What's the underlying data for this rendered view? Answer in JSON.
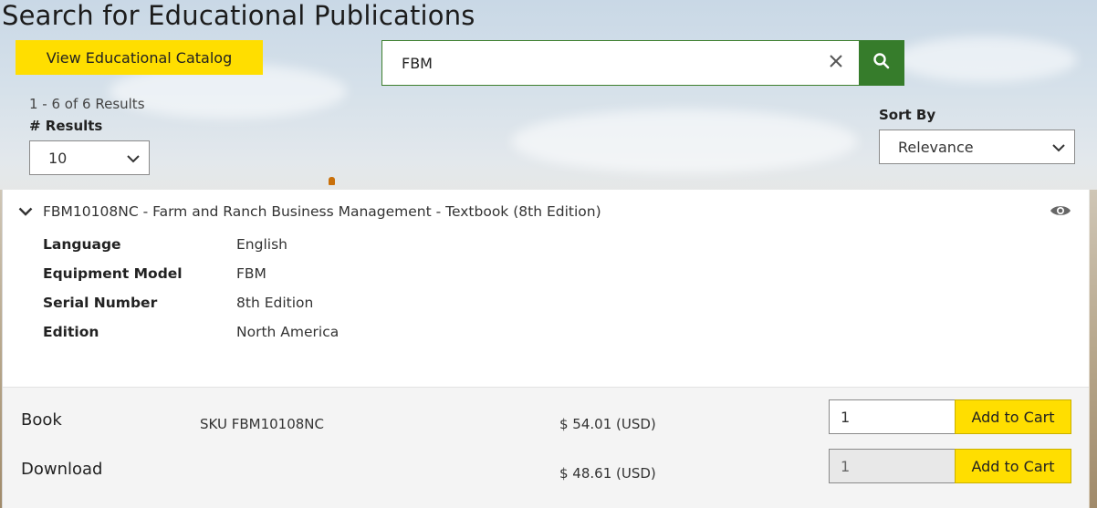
{
  "page": {
    "title": "Search for Educational Publications"
  },
  "catalog_button": {
    "label": "View Educational Catalog"
  },
  "search": {
    "value": "FBM",
    "clear_icon": "close-icon",
    "submit_icon": "search-icon"
  },
  "results": {
    "summary": "1 - 6 of 6 Results",
    "per_page_label": "# Results",
    "per_page_value": "10"
  },
  "sort": {
    "label": "Sort By",
    "value": "Relevance"
  },
  "item": {
    "title": "FBM10108NC - Farm and Ranch Business Management - Textbook (8th Edition)",
    "attributes": [
      {
        "label": "Language",
        "value": "English"
      },
      {
        "label": "Equipment Model",
        "value": "FBM"
      },
      {
        "label": "Serial Number",
        "value": "8th Edition"
      },
      {
        "label": "Edition",
        "value": "North America"
      }
    ],
    "formats": [
      {
        "name": "Book",
        "sku": "SKU FBM10108NC",
        "price": "$ 54.01 (USD)",
        "qty": "1",
        "button": "Add to Cart"
      },
      {
        "name": "Download",
        "sku": "",
        "price": "$ 48.61 (USD)",
        "qty": "1",
        "button": "Add to Cart"
      }
    ]
  },
  "colors": {
    "brand_green": "#367c2b",
    "brand_yellow": "#ffde00"
  }
}
